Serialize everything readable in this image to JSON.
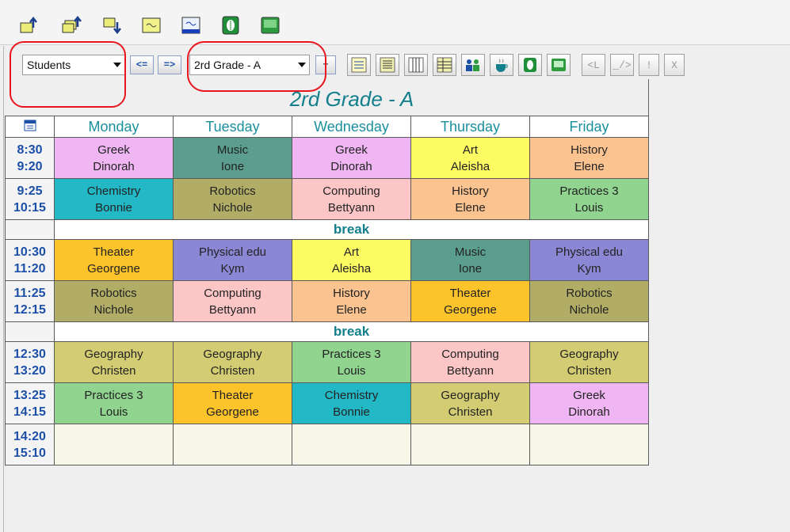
{
  "top_toolbar": {
    "icons": [
      "import-up-icon",
      "import-stack-icon",
      "export-down-icon",
      "note-icon",
      "monitor-icon",
      "leaf-icon",
      "grid-icon"
    ]
  },
  "view_select": {
    "value": "Students"
  },
  "class_select": {
    "value": "2rd Grade - A"
  },
  "nav": {
    "prev": "<=",
    "next": "=>",
    "add": "+"
  },
  "tools": {
    "icons": [
      "form-icon",
      "list-icon",
      "columns-icon",
      "rows-icon",
      "people-icon",
      "cup-icon",
      "leaf-icon",
      "screen-icon"
    ],
    "dim_labels": [
      "<L",
      "_/>",
      "!",
      "X"
    ]
  },
  "timetable": {
    "title": "2rd Grade - A",
    "days": [
      "Monday",
      "Tuesday",
      "Wednesday",
      "Thursday",
      "Friday"
    ],
    "break_label": "break",
    "rows": [
      {
        "type": "lesson",
        "start": "8:30",
        "end": "9:20",
        "cells": [
          {
            "subject": "Greek",
            "teacher": "Dinorah",
            "color": "#f0b6f4"
          },
          {
            "subject": "Music",
            "teacher": "Ione",
            "color": "#5b9e8e"
          },
          {
            "subject": "Greek",
            "teacher": "Dinorah",
            "color": "#f0b6f4"
          },
          {
            "subject": "Art",
            "teacher": "Aleisha",
            "color": "#fdfb62"
          },
          {
            "subject": "History",
            "teacher": "Elene",
            "color": "#fbc390"
          }
        ]
      },
      {
        "type": "lesson",
        "start": "9:25",
        "end": "10:15",
        "cells": [
          {
            "subject": "Chemistry",
            "teacher": "Bonnie",
            "color": "#23b8c6"
          },
          {
            "subject": "Robotics",
            "teacher": "Nichole",
            "color": "#b2ad66"
          },
          {
            "subject": "Computing",
            "teacher": "Bettyann",
            "color": "#fcc6c6"
          },
          {
            "subject": "History",
            "teacher": "Elene",
            "color": "#fbc390"
          },
          {
            "subject": "Practices 3",
            "teacher": "Louis",
            "color": "#90d490"
          }
        ]
      },
      {
        "type": "break"
      },
      {
        "type": "lesson",
        "start": "10:30",
        "end": "11:20",
        "cells": [
          {
            "subject": "Theater",
            "teacher": "Georgene",
            "color": "#fdc32b"
          },
          {
            "subject": "Physical edu",
            "teacher": "Kym",
            "color": "#8a88d4"
          },
          {
            "subject": "Art",
            "teacher": "Aleisha",
            "color": "#fdfb62"
          },
          {
            "subject": "Music",
            "teacher": "Ione",
            "color": "#5b9e8e"
          },
          {
            "subject": "Physical edu",
            "teacher": "Kym",
            "color": "#8a88d4"
          }
        ]
      },
      {
        "type": "lesson",
        "start": "11:25",
        "end": "12:15",
        "cells": [
          {
            "subject": "Robotics",
            "teacher": "Nichole",
            "color": "#b2ad66"
          },
          {
            "subject": "Computing",
            "teacher": "Bettyann",
            "color": "#fcc6c6"
          },
          {
            "subject": "History",
            "teacher": "Elene",
            "color": "#fbc390"
          },
          {
            "subject": "Theater",
            "teacher": "Georgene",
            "color": "#fdc32b"
          },
          {
            "subject": "Robotics",
            "teacher": "Nichole",
            "color": "#b2ad66"
          }
        ]
      },
      {
        "type": "break"
      },
      {
        "type": "lesson",
        "start": "12:30",
        "end": "13:20",
        "cells": [
          {
            "subject": "Geography",
            "teacher": "Christen",
            "color": "#d3cc72"
          },
          {
            "subject": "Geography",
            "teacher": "Christen",
            "color": "#d3cc72"
          },
          {
            "subject": "Practices 3",
            "teacher": "Louis",
            "color": "#90d490"
          },
          {
            "subject": "Computing",
            "teacher": "Bettyann",
            "color": "#fcc6c6"
          },
          {
            "subject": "Geography",
            "teacher": "Christen",
            "color": "#d3cc72"
          }
        ]
      },
      {
        "type": "lesson",
        "start": "13:25",
        "end": "14:15",
        "cells": [
          {
            "subject": "Practices 3",
            "teacher": "Louis",
            "color": "#90d490"
          },
          {
            "subject": "Theater",
            "teacher": "Georgene",
            "color": "#fdc32b"
          },
          {
            "subject": "Chemistry",
            "teacher": "Bonnie",
            "color": "#23b8c6"
          },
          {
            "subject": "Geography",
            "teacher": "Christen",
            "color": "#d3cc72"
          },
          {
            "subject": "Greek",
            "teacher": "Dinorah",
            "color": "#f0b6f4"
          }
        ]
      },
      {
        "type": "lesson",
        "start": "14:20",
        "end": "15:10",
        "cells": [
          {
            "subject": "",
            "teacher": "",
            "color": ""
          },
          {
            "subject": "",
            "teacher": "",
            "color": ""
          },
          {
            "subject": "",
            "teacher": "",
            "color": ""
          },
          {
            "subject": "",
            "teacher": "",
            "color": ""
          },
          {
            "subject": "",
            "teacher": "",
            "color": ""
          }
        ]
      }
    ]
  }
}
